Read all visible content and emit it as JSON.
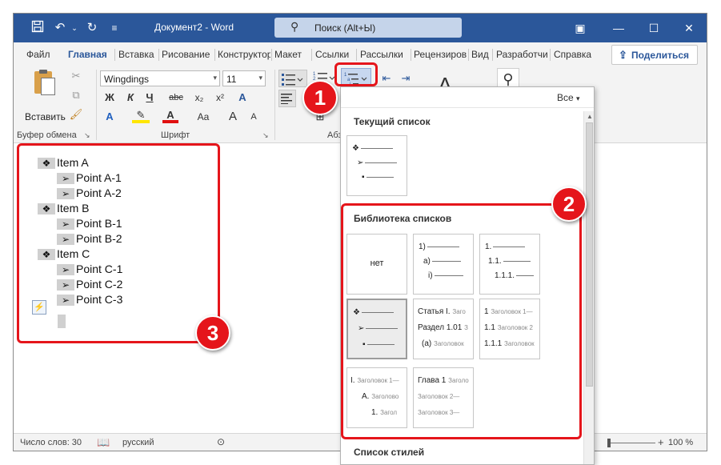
{
  "titlebar": {
    "title": "Документ2  -  Word",
    "search_placeholder": "Поиск (Alt+Ы)",
    "save_icon": "save-icon",
    "undo_icon": "undo-icon",
    "redo_icon": "redo-icon",
    "customize_icon": "customize-qat-icon",
    "win_buttons": [
      "ribbon-display-icon",
      "minimize-icon",
      "maximize-icon",
      "close-icon"
    ]
  },
  "tabs": [
    "Файл",
    "Главная",
    "Вставка",
    "Рисование",
    "Конструктор",
    "Макет",
    "Ссылки",
    "Рассылки",
    "Рецензирование",
    "Вид",
    "Разработчик",
    "Справка"
  ],
  "active_tab": "Главная",
  "share_label": "Поделиться",
  "ribbon": {
    "paste_label": "Вставить",
    "clipboard_group": "Буфер обмена",
    "font_name": "Wingdings",
    "font_size": "11",
    "font_group": "Шрифт",
    "paragraph_group": "Абзац",
    "font_buttons": {
      "bold": "Ж",
      "italic": "К",
      "underline": "Ч",
      "strike": "abc",
      "subscript": "x₂",
      "superscript": "x²",
      "font_color": "A",
      "change_case": "Aa",
      "grow": "A",
      "shrink": "A"
    }
  },
  "document": {
    "lines": [
      {
        "level": 1,
        "bullet": "❖",
        "text": "Item A"
      },
      {
        "level": 2,
        "bullet": "➢",
        "text": "Point A-1"
      },
      {
        "level": 2,
        "bullet": "➢",
        "text": "Point A-2"
      },
      {
        "level": 1,
        "bullet": "❖",
        "text": "Item B"
      },
      {
        "level": 2,
        "bullet": "➢",
        "text": "Point B-1"
      },
      {
        "level": 2,
        "bullet": "➢",
        "text": "Point B-2"
      },
      {
        "level": 1,
        "bullet": "❖",
        "text": "Item C"
      },
      {
        "level": 2,
        "bullet": "➢",
        "text": "Point C-1"
      },
      {
        "level": 2,
        "bullet": "➢",
        "text": "Point C-2"
      },
      {
        "level": 2,
        "bullet": "➢",
        "text": "Point C-3"
      }
    ]
  },
  "statusbar": {
    "word_count": "Число слов: 30",
    "language": "русский",
    "zoom": "100 %"
  },
  "dropdown": {
    "filter_label": "Все",
    "current_list_header": "Текущий список",
    "library_header": "Библиотека списков",
    "styles_header": "Список стилей",
    "none_label": "нет",
    "tile_numbered": [
      "1)",
      "a)",
      "i)"
    ],
    "tile_decimal": [
      "1.",
      "1.1.",
      "1.1.1."
    ],
    "tile_article": [
      "Статья I.",
      "Заго",
      "Раздел 1.01",
      "З",
      "(a)",
      "Заголовок"
    ],
    "tile_heading_num": [
      "1",
      "Заголовок 1—",
      "1.1",
      "Заголовок 2",
      "1.1.1",
      "Заголовок"
    ],
    "tile_roman": [
      "I.",
      "Заголовок 1—",
      "A.",
      "Заголово",
      "1.",
      "Загол"
    ],
    "tile_chapter": [
      "Глава 1",
      "Заголо",
      "Заголовок 2—",
      "Заголовок 3—"
    ]
  },
  "annotations": {
    "badge1": "1",
    "badge2": "2",
    "badge3": "3"
  },
  "colors": {
    "accent": "#2b579a",
    "annotation": "#e5151b"
  }
}
